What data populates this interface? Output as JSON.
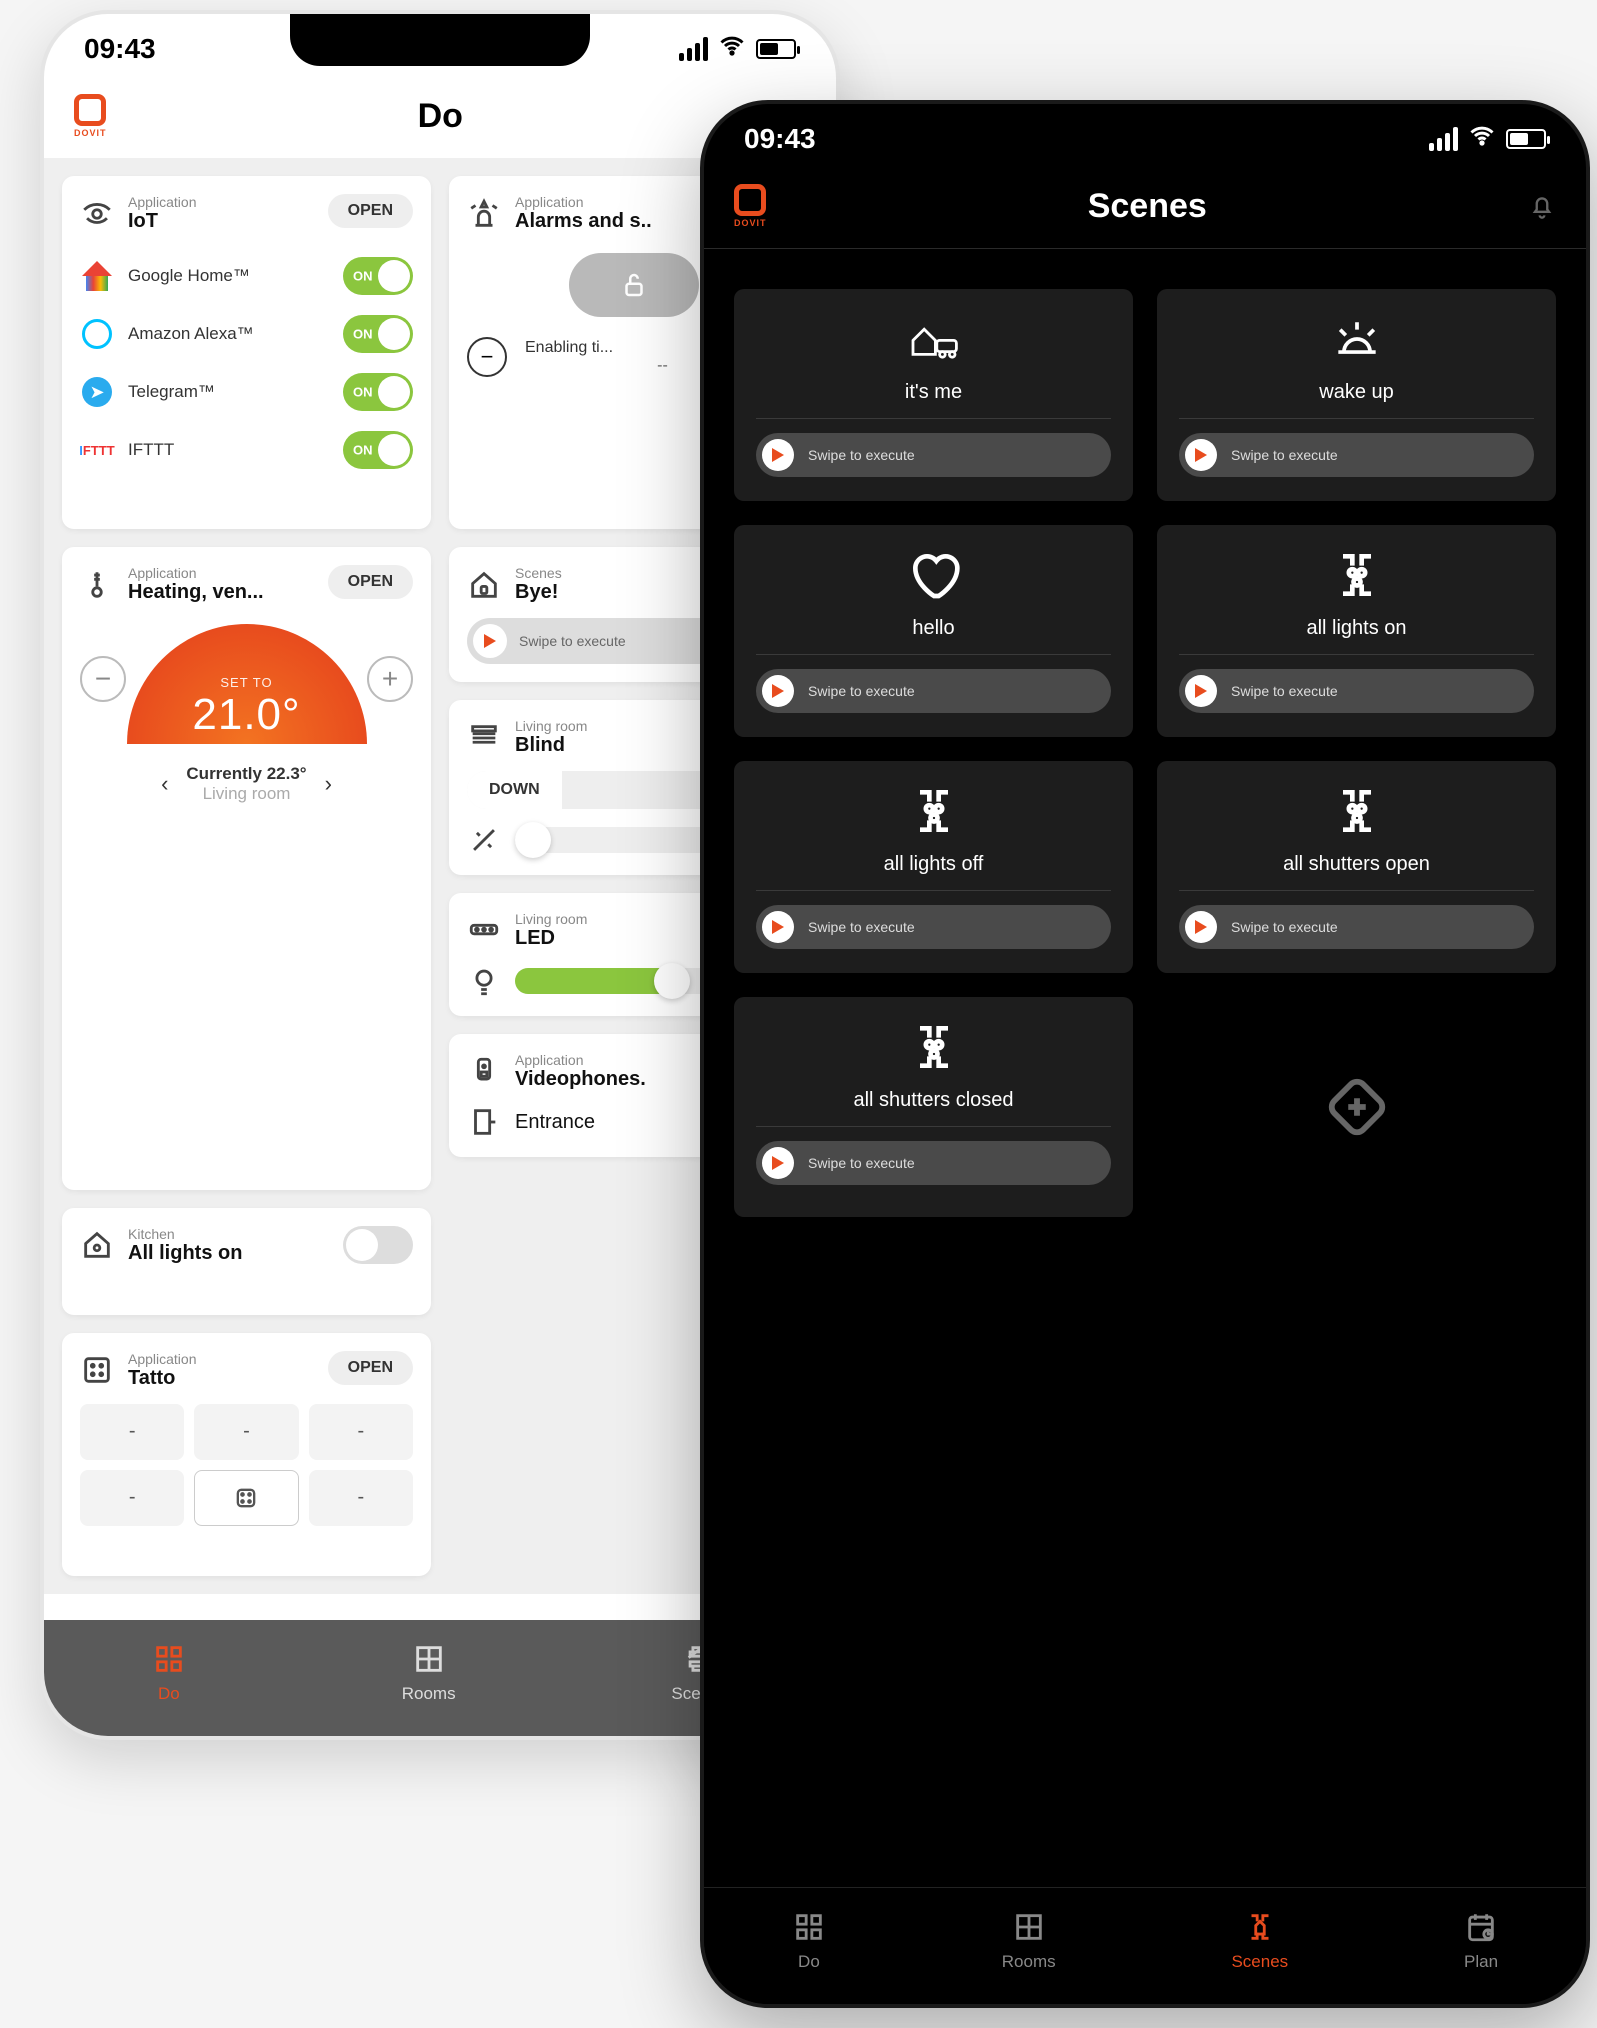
{
  "statusbar": {
    "time": "09:43"
  },
  "light": {
    "appbar_title": "Do",
    "logo_text": "DOVIT",
    "open_label": "OPEN",
    "iot": {
      "section_label": "Application",
      "title": "IoT",
      "services": [
        {
          "name": "Google Home™",
          "on": true,
          "on_label": "ON"
        },
        {
          "name": "Amazon Alexa™",
          "on": true,
          "on_label": "ON"
        },
        {
          "name": "Telegram™",
          "on": true,
          "on_label": "ON"
        },
        {
          "name": "IFTTT",
          "on": true,
          "on_label": "ON"
        }
      ]
    },
    "alarms": {
      "section_label": "Application",
      "title": "Alarms and s..",
      "enabling_label": "Enabling ti...",
      "enabling_value": "--"
    },
    "heating": {
      "section_label": "Application",
      "title": "Heating, ven...",
      "set_to_label": "SET TO",
      "set_to_value": "21.0°",
      "currently_label": "Currently 22.3°",
      "room": "Living room"
    },
    "bye": {
      "section_label": "Scenes",
      "title": "Bye!",
      "swipe_label": "Swipe to execute"
    },
    "blind": {
      "section_label": "Living room",
      "title": "Blind",
      "down_label": "DOWN"
    },
    "kitchen": {
      "section_label": "Kitchen",
      "title": "All lights on"
    },
    "led": {
      "section_label": "Living room",
      "title": "LED"
    },
    "tatto": {
      "section_label": "Application",
      "title": "Tatto",
      "keys": [
        "-",
        "-",
        "-",
        "-",
        "[ ]",
        "-"
      ]
    },
    "video": {
      "section_label": "Application",
      "title": "Videophones.",
      "entrance_label": "Entrance"
    },
    "tabs": {
      "do": "Do",
      "rooms": "Rooms",
      "scenes": "Scenes"
    }
  },
  "dark": {
    "appbar_title": "Scenes",
    "logo_text": "DOVIT",
    "swipe_label": "Swipe to execute",
    "scenes": [
      {
        "title": "it's me"
      },
      {
        "title": "wake up"
      },
      {
        "title": "hello"
      },
      {
        "title": "all lights on"
      },
      {
        "title": "all lights off"
      },
      {
        "title": "all shutters open"
      },
      {
        "title": "all shutters closed"
      }
    ],
    "tabs": {
      "do": "Do",
      "rooms": "Rooms",
      "scenes": "Scenes",
      "plan": "Plan"
    }
  }
}
